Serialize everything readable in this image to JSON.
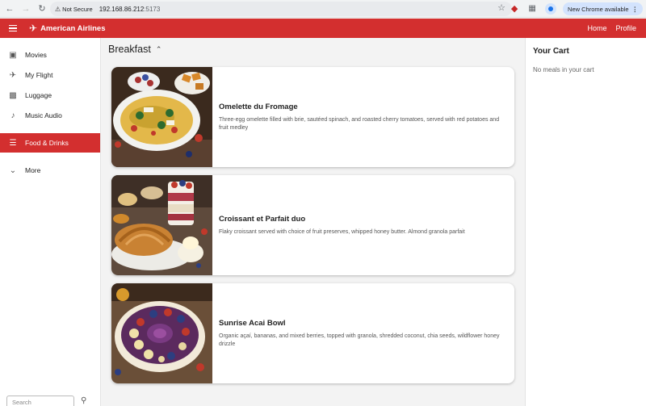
{
  "browser": {
    "security_label": "Not Secure",
    "url_host": "192.168.86.212",
    "url_port": ":5173",
    "update_label": "New Chrome available"
  },
  "header": {
    "brand": "American Airlines",
    "nav": {
      "home": "Home",
      "profile": "Profile"
    },
    "bg_color": "#d32f2f"
  },
  "sidebar": {
    "items": [
      {
        "label": "Movies",
        "icon": "film-icon"
      },
      {
        "label": "My Flight",
        "icon": "airplane-icon"
      },
      {
        "label": "Luggage",
        "icon": "luggage-icon"
      },
      {
        "label": "Music Audio",
        "icon": "music-note-icon"
      },
      {
        "label": "Food & Drinks",
        "icon": "food-icon",
        "active": true
      },
      {
        "label": "More",
        "icon": "chevron-down-icon"
      }
    ],
    "search_placeholder": "Search"
  },
  "main": {
    "section_title": "Breakfast",
    "meals": [
      {
        "name": "Omelette du Fromage",
        "description": "Three-egg omelette filled with brie, sautéed spinach, and roasted cherry tomatoes, served with red potatoes and fruit medley"
      },
      {
        "name": "Croissant et Parfait duo",
        "description": "Flaky croissant served with choice of fruit preserves, whipped honey butter. Almond granola parfait"
      },
      {
        "name": "Sunrise Acai Bowl",
        "description": "Organic açaí, bananas, and mixed berries, topped with granola, shredded coconut, chia seeds, wildflower honey drizzle"
      }
    ]
  },
  "cart": {
    "title": "Your Cart",
    "empty_text": "No meals in your cart"
  }
}
